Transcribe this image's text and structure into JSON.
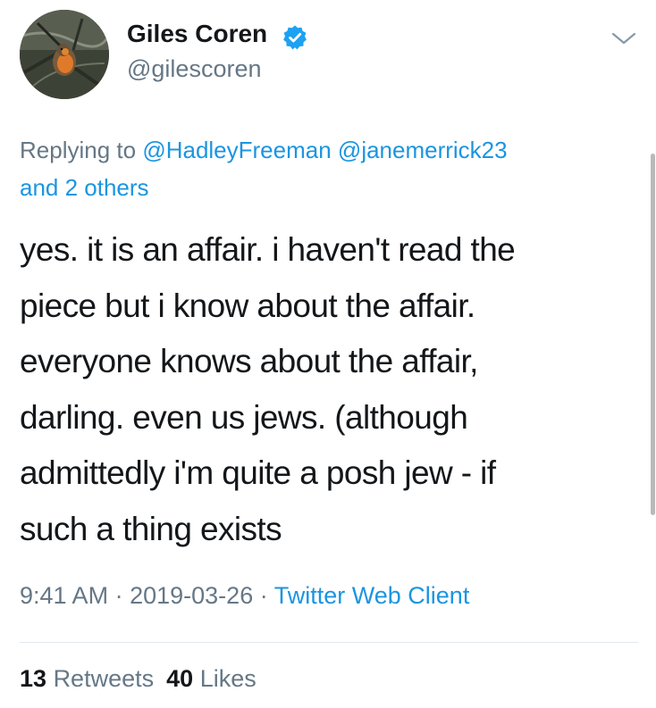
{
  "author": {
    "display_name": "Giles Coren",
    "handle": "@gilescoren",
    "verified_icon": "verified-badge-icon",
    "avatar_icon": "avatar-robin-photo"
  },
  "reply": {
    "prefix": "Replying to",
    "mention_1": "@HadleyFreeman",
    "mention_2": "@janemerrick23",
    "others": "and 2 others"
  },
  "tweet": {
    "lines": [
      "yes. it is an affair. i haven't read the",
      "piece but i know about the affair.",
      "everyone knows about the affair,",
      "darling. even us jews. (although",
      "admittedly i'm quite a posh jew - if",
      "such a thing exists"
    ]
  },
  "meta": {
    "time": "9:41 AM",
    "separator": "·",
    "date": "2019-03-26",
    "source": "Twitter Web Client"
  },
  "stats": {
    "retweets_count": "13",
    "retweets_label": "Retweets",
    "likes_count": "40",
    "likes_label": "Likes"
  },
  "colors": {
    "accent": "#1b95e0",
    "secondary_text": "#657786",
    "primary_text": "#14171a",
    "divider": "#e1e8ed"
  }
}
